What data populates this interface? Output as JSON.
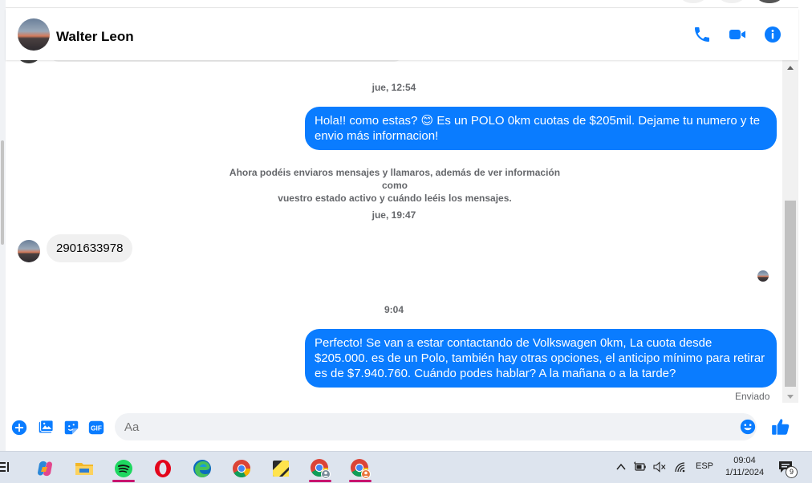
{
  "contact": {
    "name": "Walter Leon"
  },
  "header_icons": [
    "phone-icon",
    "video-camera-icon",
    "info-icon"
  ],
  "messages": {
    "ts1": "jue, 12:54",
    "msg1": "Hola!! como estas? 😊 Es un POLO 0km cuotas de $205mil. Dejame tu numero y te envio más informacion!",
    "system_notice_line1": "Ahora podéis enviaros mensajes y llamaros, además de ver información como",
    "system_notice_line2": "vuestro estado activo y cuándo leéis los mensajes.",
    "ts2": "jue, 19:47",
    "msg2": "2901633978",
    "ts3": "9:04",
    "msg3": "Perfecto!  Se van a estar contactando de Volkswagen 0km, La cuota desde $205.000. es de un Polo, también hay otras opciones, el anticipo mínimo para retirar es de $7.940.760. Cuándo podes hablar? A la mañana o a la tarde?",
    "status": "Enviado"
  },
  "composer": {
    "placeholder": "Aa",
    "icons": [
      "plus-icon",
      "gallery-icon",
      "sticker-icon",
      "gif-icon",
      "emoji-icon",
      "thumbs-up-icon"
    ],
    "gif_label": "GIF"
  },
  "taskbar": {
    "apps": [
      "widgets-icon",
      "copilot-icon",
      "file-explorer-icon",
      "spotify-icon",
      "opera-icon",
      "edge-icon",
      "chrome-icon",
      "sticky-notes-icon",
      "chrome-profile-1-icon",
      "chrome-profile-2-icon"
    ],
    "language": "ESP",
    "time": "09:04",
    "date": "1/11/2024",
    "notification_count": "9"
  },
  "colors": {
    "messenger_blue": "#0a7cff",
    "incoming_bubble": "#f0f0f0",
    "muted_text": "#65676b",
    "taskbar": "#dde4ee"
  }
}
